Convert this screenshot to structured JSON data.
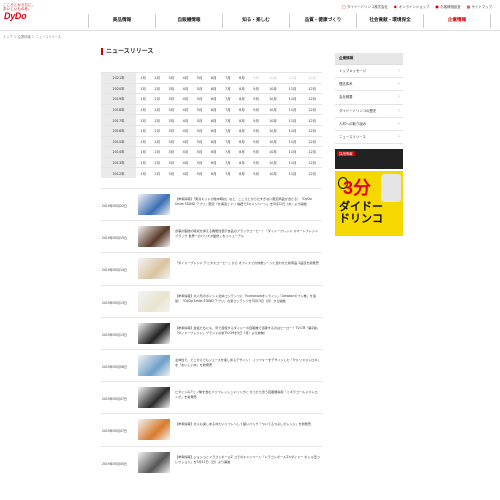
{
  "header": {
    "tagline_line1": "こころとからだに、",
    "tagline_line2": "おいしいものを。",
    "logo": "DyDo",
    "util": [
      {
        "icon": "lock-icon",
        "label": "ダイドードリンコ株式会社"
      },
      {
        "icon": "cart-icon",
        "label": "オンラインショップ"
      },
      {
        "icon": "person-icon",
        "label": "お客様相談室"
      },
      {
        "icon": "sitemap-icon",
        "label": "サイトマップ"
      }
    ]
  },
  "gnav": [
    {
      "label": "商品情報"
    },
    {
      "label": "自販機情報"
    },
    {
      "label": "知る・楽しむ"
    },
    {
      "label": "品質・健康づくり"
    },
    {
      "label": "社会貢献・環境保全"
    },
    {
      "label": "企業情報"
    }
  ],
  "breadcrumb": "トップ ＞ 企業情報 ＞ ニュースリリース",
  "page_title": "ニュースリリース",
  "archive": {
    "years": [
      "2021年",
      "2020年",
      "2019年",
      "2018年",
      "2017年",
      "2016年",
      "2015年",
      "2014年",
      "2013年",
      "2012年"
    ],
    "months": [
      "1月",
      "2月",
      "3月",
      "4月",
      "5月",
      "6月",
      "7月",
      "8月",
      "9月",
      "10月",
      "11月",
      "12月"
    ]
  },
  "news": [
    {
      "date": "2019年05月22日",
      "text": "【参考情報】「笑点キッドの懐中時計」など、こころとからだすぎない限定商品が当たる！「DyDo Smile STAND アプリ」限定「北海道ミドリ 抽選で3キャンペーン」を5月22日（水）より開始"
    },
    {
      "date": "2019年05月15日",
      "text": "食事の脂肪の吸収を抑える機能性表示食品のブラックコーヒー！「ダイドーブレンド スマートブレンドブラック 世界一のバリスタ監修」をリニューアル"
    },
    {
      "date": "2019年05月14日",
      "text": "「ダイドーブレンド デミタスコーヒー」から オフィスでの休憩シーンに合わせた新商品 2品目を新発売"
    },
    {
      "date": "2019年05月13日",
      "text": "【参考情報】大人気のポイント交換コンテンツに「humanoidオンライン」「Amazonギフト券」を追加！「DyDo Smile STAND アプリ」の新コンテンツを5月13日（月）から開始"
    },
    {
      "date": "2019年05月13日",
      "text": "【参考情報】並坂たちにも、皆で自慢するダイドーの自販機で活躍するのはヒーロー！TV-CM「第2弾」「ダイドーブレンド」ブランドの新TV-CMを5日（月）より放映！"
    },
    {
      "date": "2019年05月08日",
      "text": "主体性で、どこからでもジュースを楽しめるデザイン！ イツフォーをデザインした「5つ リスストロネ」を「おいしい水」を新発売"
    },
    {
      "date": "2019年05月07日",
      "text": "ビタミン&アミノ酸を含むパリフレッシュドリンクに ぴったり合う自販機専用「ミネラゴールドストロング」を新発売"
    },
    {
      "date": "2019年05月07日",
      "text": "【参考情報】大人も楽しめるゆたいリフレ〜して組いパンク「ついてるつぶしオレンジ」を新発売"
    },
    {
      "date": "2019年05月05日",
      "text": "【参考情報】ジョジョとドラゴンボールZ コラボキャンペーン「ドラゴンボールZ×ダイドー ボトル缶コレクション」を5月11日（日）より開始"
    }
  ],
  "sidebar": {
    "heading": "企業情報",
    "items": [
      "トップメッセージ",
      "理念体系",
      "会社概要",
      "ダイドードリンコの歴史",
      "人材への取り組み",
      "ニュースリリース"
    ],
    "banner1_label": "採用情報",
    "banner2_big": "3分",
    "banner2_sub1": "ダイドー",
    "banner2_sub2": "ドリンコ"
  }
}
